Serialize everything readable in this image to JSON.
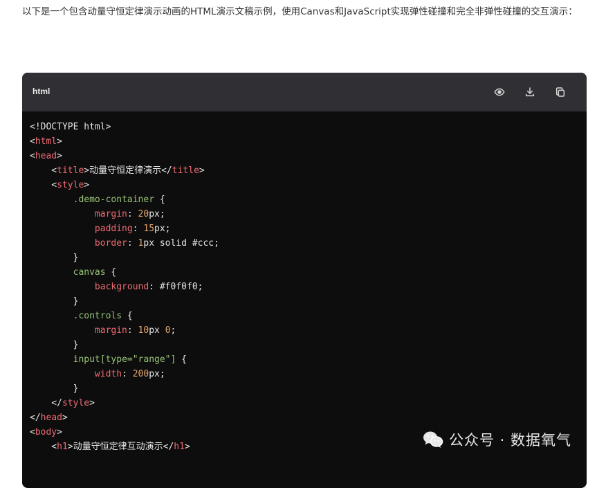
{
  "intro_text": "以下是一个包含动量守恒定律演示动画的HTML演示文稿示例，使用Canvas和JavaScript实现弹性碰撞和完全非弹性碰撞的交互演示：",
  "code_block": {
    "language": "html",
    "actions": [
      "eye-icon",
      "download-icon",
      "copy-icon"
    ],
    "lines": [
      [
        [
          "t-plain",
          "<!DOCTYPE html>"
        ]
      ],
      [
        [
          "t-plain",
          "<"
        ],
        [
          "t-tag",
          "html"
        ],
        [
          "t-plain",
          ">"
        ]
      ],
      [
        [
          "t-plain",
          "<"
        ],
        [
          "t-tag",
          "head"
        ],
        [
          "t-plain",
          ">"
        ]
      ],
      [
        [
          "t-plain",
          "    <"
        ],
        [
          "t-tag",
          "title"
        ],
        [
          "t-plain",
          ">动量守恒定律演示</"
        ],
        [
          "t-tag",
          "title"
        ],
        [
          "t-plain",
          ">"
        ]
      ],
      [
        [
          "t-plain",
          "    <"
        ],
        [
          "t-tag",
          "style"
        ],
        [
          "t-plain",
          ">"
        ]
      ],
      [
        [
          "t-plain",
          "        "
        ],
        [
          "t-sel",
          ".demo-container"
        ],
        [
          "t-plain",
          " {"
        ]
      ],
      [
        [
          "t-plain",
          "            "
        ],
        [
          "t-prop",
          "margin"
        ],
        [
          "t-plain",
          ": "
        ],
        [
          "t-num",
          "20"
        ],
        [
          "t-plain",
          "px;"
        ]
      ],
      [
        [
          "t-plain",
          "            "
        ],
        [
          "t-prop",
          "padding"
        ],
        [
          "t-plain",
          ": "
        ],
        [
          "t-num",
          "15"
        ],
        [
          "t-plain",
          "px;"
        ]
      ],
      [
        [
          "t-plain",
          "            "
        ],
        [
          "t-prop",
          "border"
        ],
        [
          "t-plain",
          ": "
        ],
        [
          "t-num",
          "1"
        ],
        [
          "t-plain",
          "px solid #ccc;"
        ]
      ],
      [
        [
          "t-plain",
          "        }"
        ]
      ],
      [
        [
          "t-plain",
          "        "
        ],
        [
          "t-sel",
          "canvas"
        ],
        [
          "t-plain",
          " {"
        ]
      ],
      [
        [
          "t-plain",
          "            "
        ],
        [
          "t-prop",
          "background"
        ],
        [
          "t-plain",
          ": #f0f0f0;"
        ]
      ],
      [
        [
          "t-plain",
          "        }"
        ]
      ],
      [
        [
          "t-plain",
          "        "
        ],
        [
          "t-sel",
          ".controls"
        ],
        [
          "t-plain",
          " {"
        ]
      ],
      [
        [
          "t-plain",
          "            "
        ],
        [
          "t-prop",
          "margin"
        ],
        [
          "t-plain",
          ": "
        ],
        [
          "t-num",
          "10"
        ],
        [
          "t-plain",
          "px "
        ],
        [
          "t-num",
          "0"
        ],
        [
          "t-plain",
          ";"
        ]
      ],
      [
        [
          "t-plain",
          "        }"
        ]
      ],
      [
        [
          "t-plain",
          "        "
        ],
        [
          "t-sel",
          "input[type="
        ],
        [
          "t-str",
          "\"range\""
        ],
        [
          "t-sel",
          "]"
        ],
        [
          "t-plain",
          " {"
        ]
      ],
      [
        [
          "t-plain",
          "            "
        ],
        [
          "t-prop",
          "width"
        ],
        [
          "t-plain",
          ": "
        ],
        [
          "t-num",
          "200"
        ],
        [
          "t-plain",
          "px;"
        ]
      ],
      [
        [
          "t-plain",
          "        }"
        ]
      ],
      [
        [
          "t-plain",
          "    </"
        ],
        [
          "t-tag",
          "style"
        ],
        [
          "t-plain",
          ">"
        ]
      ],
      [
        [
          "t-plain",
          "</"
        ],
        [
          "t-tag",
          "head"
        ],
        [
          "t-plain",
          ">"
        ]
      ],
      [
        [
          "t-plain",
          "<"
        ],
        [
          "t-tag",
          "body"
        ],
        [
          "t-plain",
          ">"
        ]
      ],
      [
        [
          "t-plain",
          "    <"
        ],
        [
          "t-tag",
          "h1"
        ],
        [
          "t-plain",
          ">动量守恒定律互动演示</"
        ],
        [
          "t-tag",
          "h1"
        ],
        [
          "t-plain",
          ">"
        ]
      ]
    ]
  },
  "watermark": {
    "text": "公众号 · 数据氧气",
    "icon": "wechat-icon"
  }
}
